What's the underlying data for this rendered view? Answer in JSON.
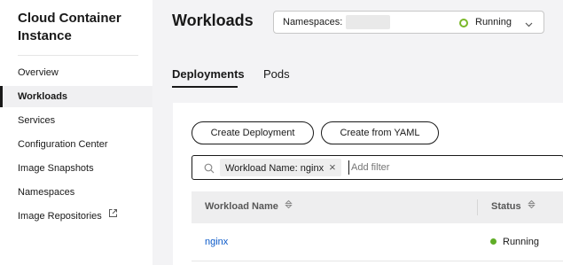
{
  "sidebar": {
    "app_title": "Cloud Container Instance",
    "items": [
      {
        "label": "Overview"
      },
      {
        "label": "Workloads"
      },
      {
        "label": "Services"
      },
      {
        "label": "Configuration Center"
      },
      {
        "label": "Image Snapshots"
      },
      {
        "label": "Namespaces"
      },
      {
        "label": "Image Repositories"
      }
    ]
  },
  "header": {
    "title": "Workloads",
    "namespace_label": "Namespaces:",
    "namespace_status": "Running"
  },
  "tabs": [
    {
      "label": "Deployments",
      "active": true
    },
    {
      "label": "Pods",
      "active": false
    }
  ],
  "toolbar": {
    "create_deployment": "Create Deployment",
    "create_from_yaml": "Create from YAML"
  },
  "filter": {
    "chip": "Workload Name: nginx",
    "placeholder": "Add filter"
  },
  "table": {
    "columns": [
      "Workload Name",
      "Status"
    ],
    "rows": [
      {
        "name": "nginx",
        "status": "Running"
      }
    ]
  },
  "colors": {
    "link": "#0a59c9",
    "running": "#5fad26",
    "border": "#191919"
  }
}
